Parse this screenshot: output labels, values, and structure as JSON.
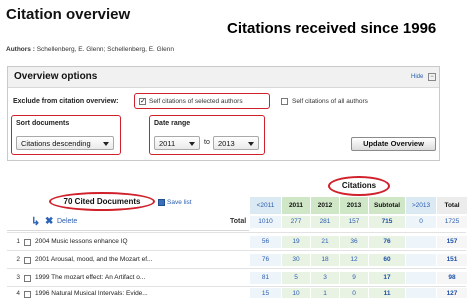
{
  "header": {
    "title": "Citation overview",
    "banner": "Citations received since 1996",
    "authors_label": "Authors :",
    "authors_value": "Schellenberg, E. Glenn; Schellenberg, E. Glenn"
  },
  "overview": {
    "title": "Overview options",
    "hide_label": "Hide",
    "hide_icon": "collapse-icon",
    "exclude_label": "Exclude from citation overview:",
    "self_citations_selected": {
      "label": "Self citations of selected authors",
      "checked": true
    },
    "self_citations_all": {
      "label": "Self citations of all authors",
      "checked": false
    },
    "sort": {
      "label": "Sort documents",
      "selected": "Citations descending"
    },
    "date_range": {
      "label": "Date range",
      "from": "2011",
      "to_label": "to",
      "to": "2013"
    },
    "update_button": "Update Overview"
  },
  "citations": {
    "documents_count": "70 Cited Documents",
    "save_list": "Save list",
    "delete_label": "Delete",
    "total_label": "Total",
    "citations_header": "Citations",
    "columns": [
      "<2011",
      "2011",
      "2012",
      "2013",
      "Subtotal",
      ">2013",
      "Total"
    ],
    "totals": [
      "1010",
      "277",
      "281",
      "157",
      "715",
      "0",
      "1725"
    ],
    "rows": [
      {
        "num": "1",
        "title": "2004  Music lessons enhance IQ",
        "values": [
          "56",
          "19",
          "21",
          "36",
          "76",
          "",
          "157"
        ]
      },
      {
        "num": "2",
        "title": "2001  Arousal, mood, and the Mozart ef...",
        "values": [
          "76",
          "30",
          "18",
          "12",
          "60",
          "",
          "151"
        ]
      },
      {
        "num": "3",
        "title": "1999  The mozart effect: An Artifact o...",
        "values": [
          "81",
          "5",
          "3",
          "9",
          "17",
          "",
          "98"
        ]
      },
      {
        "num": "4",
        "title": "1996  Natural Musical Intervals: Evide...",
        "values": [
          "15",
          "10",
          "1",
          "0",
          "11",
          "",
          "127"
        ]
      }
    ]
  },
  "colors": {
    "annotation_red": "#d0202a",
    "link_blue": "#2a5db0",
    "header_green": "#cfe6c7",
    "header_light": "#dbe9f3"
  }
}
